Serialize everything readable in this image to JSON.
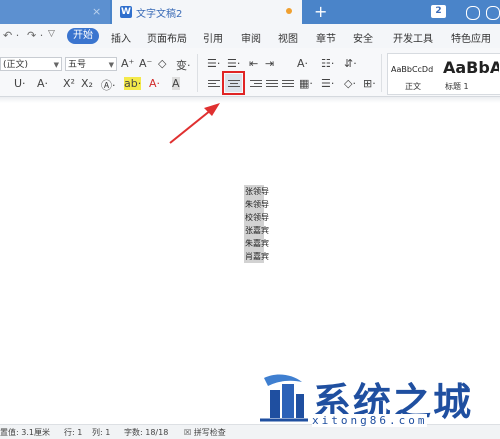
{
  "titlebar": {
    "doc_tab_title": "文字文稿2",
    "doc_icon_letter": "W",
    "close_glyph": "×",
    "new_tab_glyph": "+",
    "badge": "2"
  },
  "menu": {
    "undo_glyph": "↶ ·",
    "redo_glyph": "↷ ·",
    "qa_glyph": "▽",
    "active": "开始",
    "items": [
      "插入",
      "页面布局",
      "引用",
      "审阅",
      "视图",
      "章节",
      "安全",
      "开发工具",
      "特色应用"
    ]
  },
  "ribbon": {
    "style_combo": "(正文)",
    "size_combo": "五号",
    "font_row1": [
      "A⁺",
      "A⁻",
      "◇",
      "变·"
    ],
    "font_row2": [
      "U·",
      "A·",
      "X²",
      "X₂",
      "Ⓐ·",
      "ab·",
      "A·",
      "A"
    ],
    "para_row1": [
      "☰·",
      "☰·",
      "⇤",
      "⇥",
      "A·",
      "☷·",
      "⇵·"
    ],
    "para_row2": [
      "▦·",
      "☰·",
      "◇·",
      "⊞·"
    ],
    "styles": [
      {
        "sample": "AaBbCcDd",
        "name": "正文"
      },
      {
        "sample": "AaBbA",
        "name": "标题 1"
      }
    ]
  },
  "document": {
    "lines": [
      "张领导",
      "朱领导",
      "校领导",
      "张嘉宾",
      "朱嘉宾",
      "肖嘉宾"
    ]
  },
  "status": {
    "position": "置值: 3.1厘米",
    "row": "行: 1",
    "col": "列: 1",
    "words": "字数: 18/18",
    "spell_check": "拼写检查"
  },
  "watermark": {
    "title": "系统之城",
    "domain": "xitong86.com"
  },
  "colors": {
    "titlebar": "#4a84c9",
    "accent": "#3b75cf",
    "highlight_box": "#e02424",
    "arrow": "#e03030",
    "watermark": "#1f4fa0"
  }
}
